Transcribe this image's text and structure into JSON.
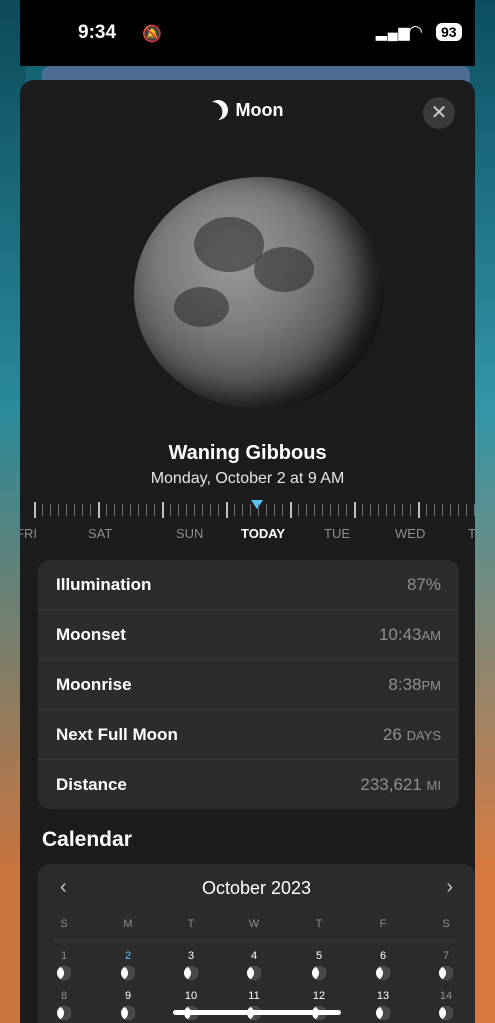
{
  "status": {
    "time": "9:34",
    "battery": "93"
  },
  "header": {
    "title": "Moon",
    "close_icon": "close-icon",
    "moon_icon": "crescent-moon-icon"
  },
  "moon": {
    "phase": "Waning Gibbous",
    "date": "Monday, October 2 at 9 AM"
  },
  "timeline": {
    "days": [
      "FRI",
      "SAT",
      "SUN",
      "TODAY",
      "TUE",
      "WED",
      "T"
    ],
    "today_index": 3
  },
  "info": {
    "illumination": {
      "label": "Illumination",
      "value": "87%"
    },
    "moonset": {
      "label": "Moonset",
      "value": "10:43",
      "unit": "AM"
    },
    "moonrise": {
      "label": "Moonrise",
      "value": "8:38",
      "unit": "PM"
    },
    "next_full": {
      "label": "Next Full Moon",
      "value": "26",
      "unit": "DAYS"
    },
    "distance": {
      "label": "Distance",
      "value": "233,621",
      "unit": "MI"
    }
  },
  "calendar": {
    "section_title": "Calendar",
    "month": "October 2023",
    "prev": "‹",
    "next": "›",
    "weekdays": [
      "S",
      "M",
      "T",
      "W",
      "T",
      "F",
      "S"
    ],
    "week1": [
      "1",
      "2",
      "3",
      "4",
      "5",
      "6",
      "7"
    ],
    "week2": [
      "8",
      "9",
      "10",
      "11",
      "12",
      "13",
      "14"
    ],
    "highlight_color": "#5ac8fa"
  }
}
